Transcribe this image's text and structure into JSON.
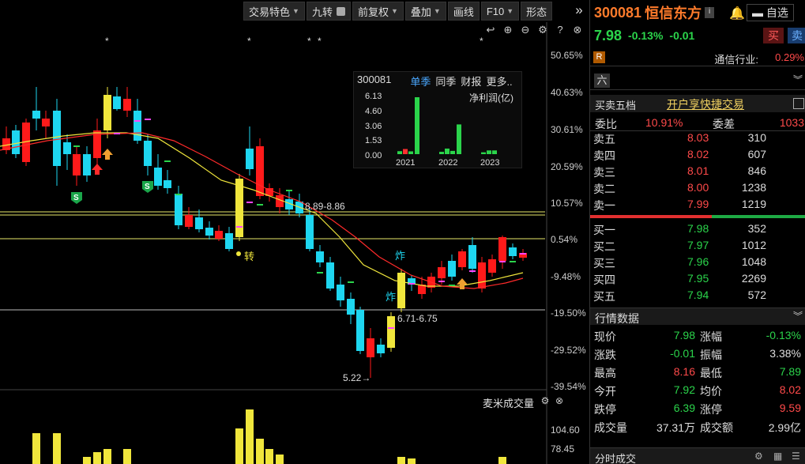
{
  "toolbar": {
    "items": [
      {
        "label": "交易特色",
        "caret": true,
        "lock": false
      },
      {
        "label": "九转",
        "caret": false,
        "lock": true
      },
      {
        "label": "前复权",
        "caret": true,
        "lock": false
      },
      {
        "label": "叠加",
        "caret": true,
        "lock": false
      },
      {
        "label": "画线",
        "caret": false,
        "lock": false
      },
      {
        "label": "F10",
        "caret": true,
        "lock": false
      },
      {
        "label": "形态",
        "caret": false,
        "lock": false
      }
    ],
    "collapse_icon": "double-chevron-right-icon"
  },
  "chart": {
    "y_labels": [
      "50.65%",
      "40.63%",
      "30.61%",
      "20.59%",
      "10.57%",
      "0.54%",
      "-9.48%",
      "-19.50%",
      "-29.52%",
      "-39.54%"
    ],
    "annotations": {
      "range_high": "8.89-8.86",
      "range_low": "6.71-6.75",
      "low_price": "5.22→",
      "zhuan": "转",
      "zha1": "炸",
      "zha2": "炸",
      "s_marker": "S",
      "star": "*"
    },
    "colors": {
      "up": "#ff1a1a",
      "down": "#1ed6f0",
      "yellow": "#f0e63c",
      "ma_fast": "#f0e63c",
      "ma_slow": "#ff2a2a",
      "hline": "#e8e86a"
    }
  },
  "mini_panel": {
    "code": "300081",
    "tabs": [
      "单季",
      "同季",
      "财报",
      "更多.."
    ],
    "metric": "净利润(亿)",
    "y_ticks": [
      "6.13",
      "4.60",
      "3.06",
      "1.53",
      "0.00"
    ],
    "years": [
      "2021",
      "2022",
      "2023"
    ],
    "bars": [
      {
        "v": 0.32,
        "c": "#2bd44b"
      },
      {
        "v": 0.55,
        "c": "#ff3030"
      },
      {
        "v": 0.3,
        "c": "#2bd44b"
      },
      {
        "v": 6.13,
        "c": "#2bd44b"
      },
      {
        "v": 0.25,
        "c": "#2bd44b"
      },
      {
        "v": 0.6,
        "c": "#2bd44b"
      },
      {
        "v": 0.35,
        "c": "#2bd44b"
      },
      {
        "v": 3.2,
        "c": "#2bd44b"
      },
      {
        "v": 0.2,
        "c": "#2bd44b"
      },
      {
        "v": 0.4,
        "c": "#2bd44b"
      },
      {
        "v": 0.4,
        "c": "#2bd44b"
      }
    ]
  },
  "volume": {
    "title": "麦米成交量",
    "y_labels": [
      "104.60",
      "78.45"
    ]
  },
  "quote": {
    "code": "300081",
    "name": "恒信东方",
    "watch_label": "自选",
    "price": "7.98",
    "change_pct": "-0.13%",
    "change": "-0.01",
    "buy_label": "买",
    "sell_label": "卖",
    "r_badge": "R",
    "industry": "通信行业:",
    "industry_pct": "0.29%",
    "six_label": "六"
  },
  "orderbook": {
    "title": "买卖五档",
    "quick_trade": "开户享快捷交易",
    "ratio_label": "委比",
    "ratio_value": "10.91%",
    "diff_label": "委差",
    "diff_value": "1033",
    "asks": [
      {
        "label": "卖五",
        "price": "8.03",
        "vol": "310"
      },
      {
        "label": "卖四",
        "price": "8.02",
        "vol": "607"
      },
      {
        "label": "卖三",
        "price": "8.01",
        "vol": "846"
      },
      {
        "label": "卖二",
        "price": "8.00",
        "vol": "1238"
      },
      {
        "label": "卖一",
        "price": "7.99",
        "vol": "1219"
      }
    ],
    "bids": [
      {
        "label": "买一",
        "price": "7.98",
        "vol": "352"
      },
      {
        "label": "买二",
        "price": "7.97",
        "vol": "1012"
      },
      {
        "label": "买三",
        "price": "7.96",
        "vol": "1048"
      },
      {
        "label": "买四",
        "price": "7.95",
        "vol": "2269"
      },
      {
        "label": "买五",
        "price": "7.94",
        "vol": "572"
      }
    ]
  },
  "market_data": {
    "title": "行情数据",
    "rows": [
      {
        "l1": "现价",
        "v1": "7.98",
        "c1": "grn",
        "l2": "涨幅",
        "v2": "-0.13%",
        "c2": "grn"
      },
      {
        "l1": "涨跌",
        "v1": "-0.01",
        "c1": "grn",
        "l2": "振幅",
        "v2": "3.38%",
        "c2": "wht"
      },
      {
        "l1": "最高",
        "v1": "8.16",
        "c1": "red",
        "l2": "最低",
        "v2": "7.89",
        "c2": "grn"
      },
      {
        "l1": "今开",
        "v1": "7.92",
        "c1": "grn",
        "l2": "均价",
        "v2": "8.02",
        "c2": "red"
      },
      {
        "l1": "跌停",
        "v1": "6.39",
        "c1": "grn",
        "l2": "涨停",
        "v2": "9.59",
        "c2": "red"
      },
      {
        "l1": "成交量",
        "v1": "37.31万",
        "c1": "wht",
        "l2": "成交额",
        "v2": "2.99亿",
        "c2": "wht"
      }
    ]
  },
  "timesales": {
    "title": "分时成交"
  }
}
